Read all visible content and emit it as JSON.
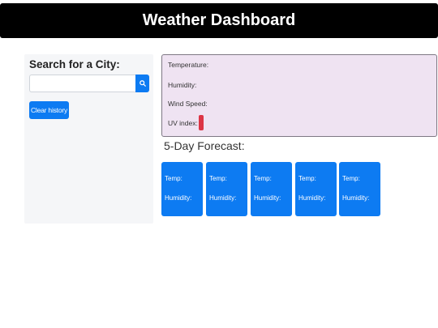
{
  "header": {
    "title": "Weather Dashboard"
  },
  "sidebar": {
    "title": "Search for a City:",
    "search": {
      "value": "",
      "placeholder": ""
    },
    "search_icon": "magnifier-icon",
    "clear_label": "Clear history"
  },
  "current": {
    "temperature_label": "Temperature:",
    "humidity_label": "Humidity:",
    "wind_label": "Wind Speed:",
    "uv_label": "UV index:"
  },
  "forecast": {
    "title": "5-Day Forecast:",
    "cards": [
      {
        "temp_label": "Temp:",
        "humidity_label": "Humidity:"
      },
      {
        "temp_label": "Temp:",
        "humidity_label": "Humidity:"
      },
      {
        "temp_label": "Temp:",
        "humidity_label": "Humidity:"
      },
      {
        "temp_label": "Temp:",
        "humidity_label": "Humidity:"
      },
      {
        "temp_label": "Temp:",
        "humidity_label": "Humidity:"
      }
    ]
  },
  "colors": {
    "header_bg": "#000000",
    "primary": "#0d7bf2",
    "current_card_bg": "#efe3f2",
    "uv_badge": "#dc3545",
    "sidebar_bg": "#f5f6f8"
  }
}
